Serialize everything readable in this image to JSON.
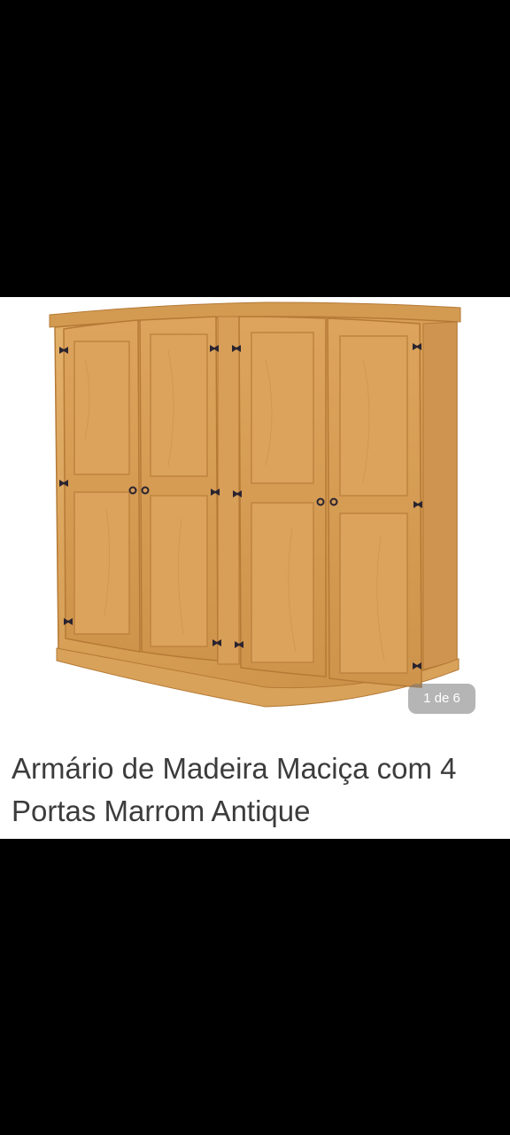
{
  "gallery": {
    "image_alt": "wardrobe-photo",
    "counter": "1 de 6"
  },
  "product": {
    "title": "Armário de Madeira Maciça com 4 Portas Marrom Antique"
  },
  "colors": {
    "wood_main": "#d9a35a",
    "wood_dark": "#b57a36",
    "wood_light": "#e8bb77",
    "hardware": "#2a2430",
    "title_text": "#3c3c3c",
    "background": "#ffffff",
    "letterbox": "#000000"
  }
}
